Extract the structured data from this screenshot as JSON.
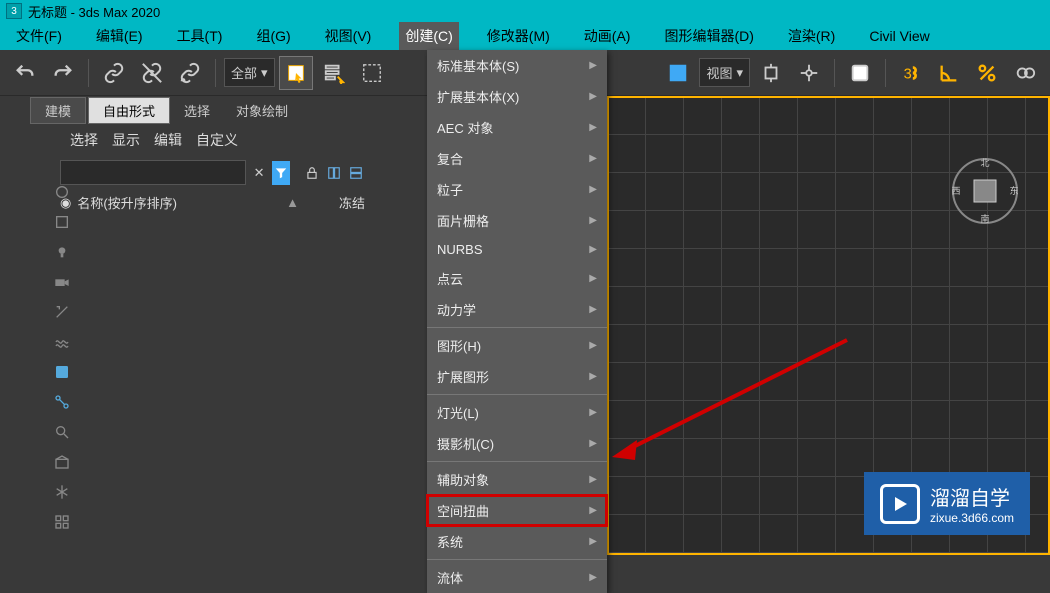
{
  "title": "无标题 - 3ds Max 2020",
  "app_icon": "3",
  "menubar": {
    "file": "文件(F)",
    "edit": "编辑(E)",
    "tools": "工具(T)",
    "group": "组(G)",
    "view": "视图(V)",
    "create": "创建(C)",
    "modifiers": "修改器(M)",
    "animation": "动画(A)",
    "graph_editors": "图形编辑器(D)",
    "rendering": "渲染(R)",
    "civil_view": "Civil View"
  },
  "toolbar": {
    "filter_dropdown": "全部",
    "view_dropdown": "视图"
  },
  "second_toolbar": {
    "modeling": "建模",
    "freeform": "自由形式",
    "selection": "选择",
    "object_paint": "对象绘制"
  },
  "panel": {
    "tabs": {
      "select": "选择",
      "display": "显示",
      "edit": "编辑",
      "customize": "自定义"
    },
    "search_placeholder": "",
    "col_name": "名称(按升序排序)",
    "col_frozen": "冻结"
  },
  "create_menu": {
    "std_primitives": "标准基本体(S)",
    "ext_primitives": "扩展基本体(X)",
    "aec": "AEC 对象",
    "compound": "复合",
    "particles": "粒子",
    "patch_grids": "面片栅格",
    "nurbs": "NURBS",
    "point_cloud": "点云",
    "dynamics": "动力学",
    "shapes": "图形(H)",
    "ext_shapes": "扩展图形",
    "lights": "灯光(L)",
    "cameras": "摄影机(C)",
    "helpers": "辅助对象",
    "space_warps": "空间扭曲",
    "systems": "系统",
    "fluids": "流体"
  },
  "nav_cube": {
    "top": "北",
    "right": "东",
    "bottom": "南",
    "left": "西"
  },
  "watermark": {
    "name": "溜溜自学",
    "url": "zixue.3d66.com"
  }
}
